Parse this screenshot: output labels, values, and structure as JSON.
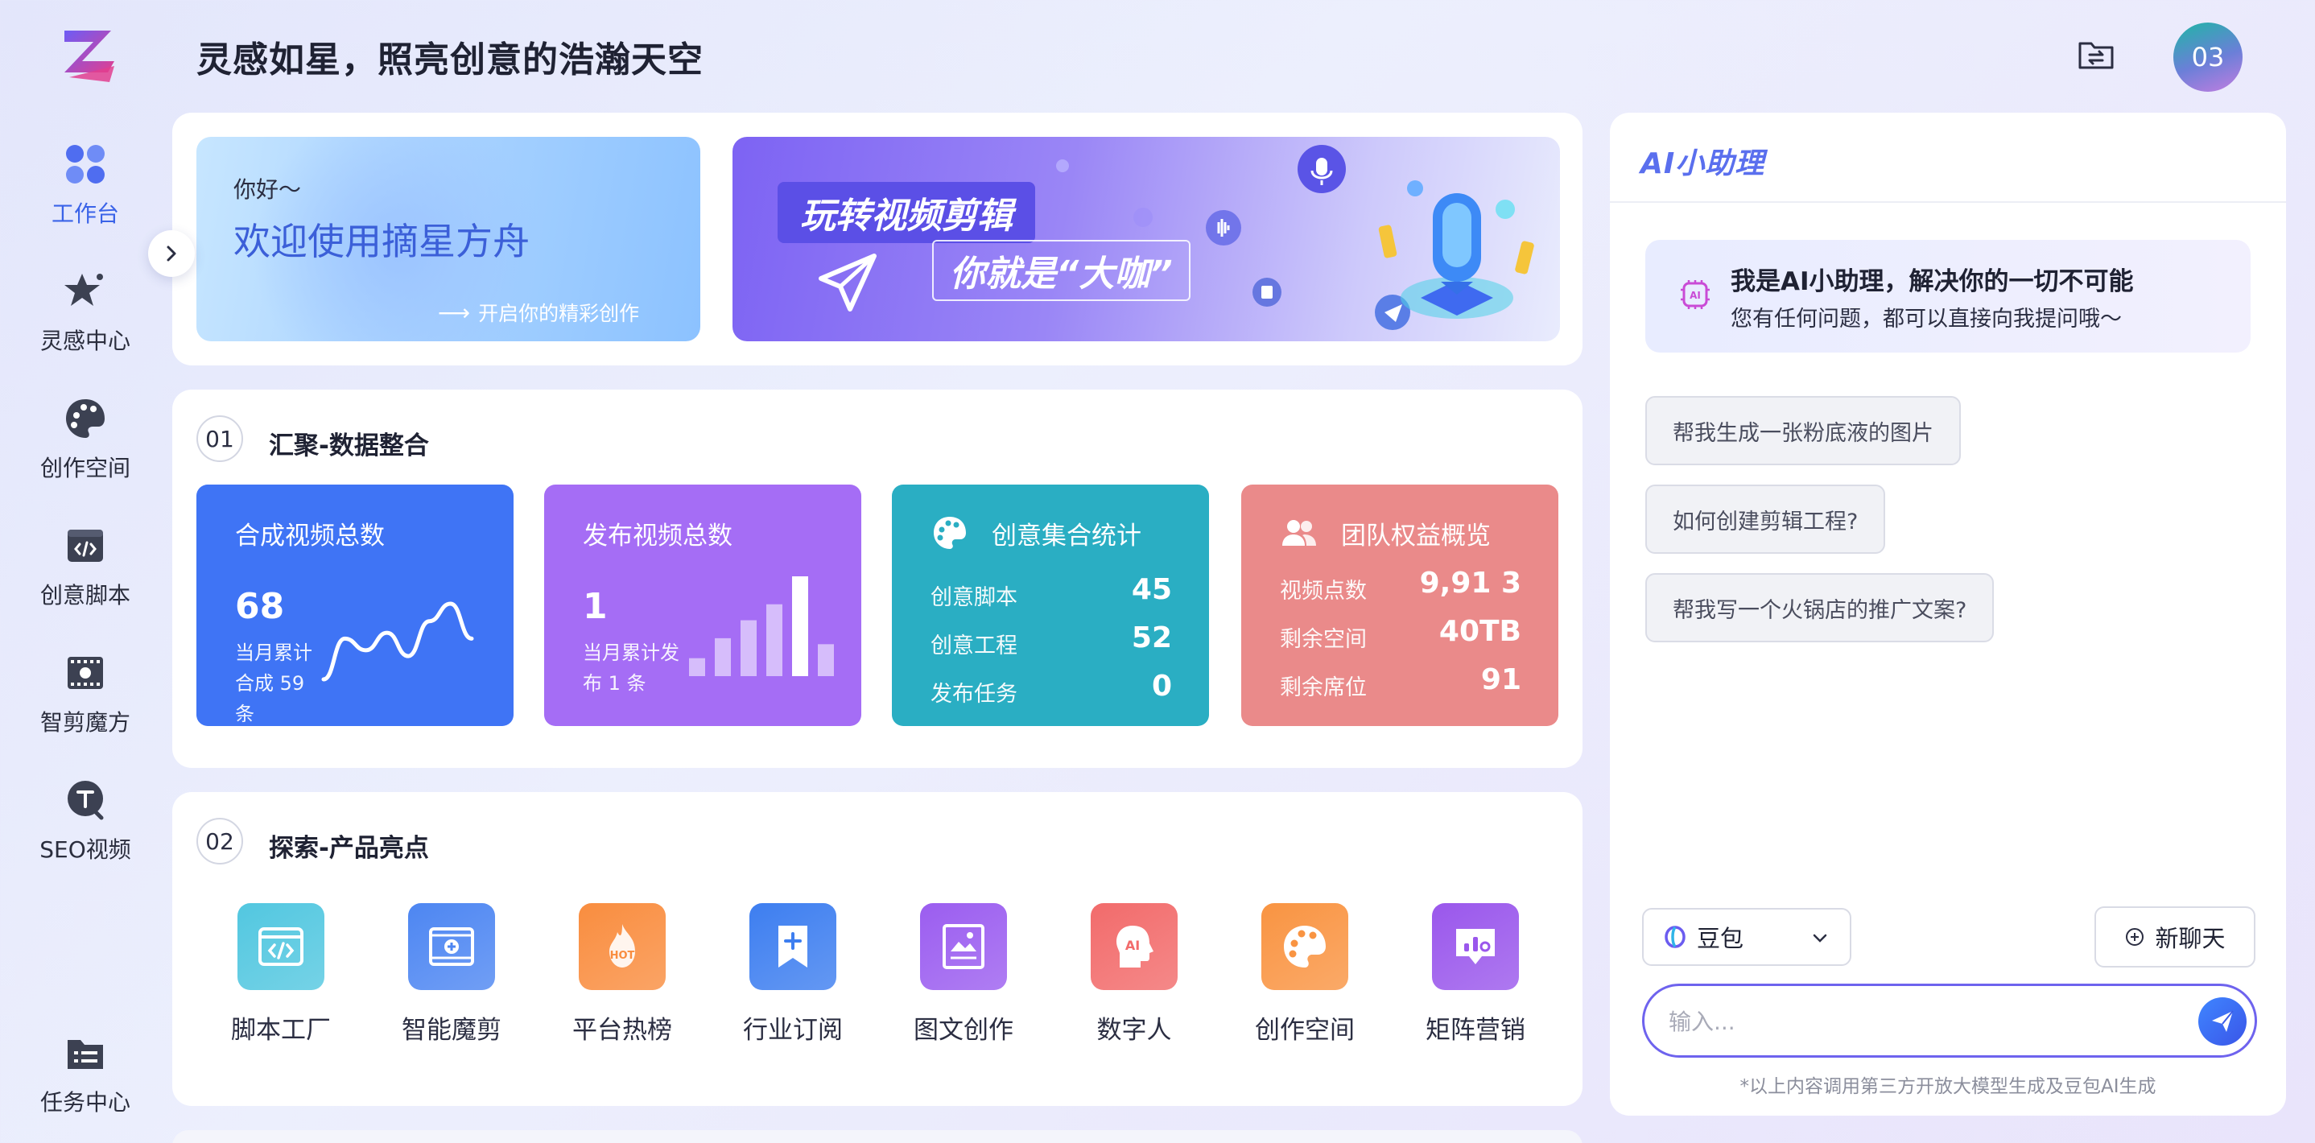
{
  "header": {
    "title": "灵感如星，照亮创意的浩瀚天空",
    "avatar_text": "03"
  },
  "sidebar": {
    "items": [
      {
        "label": "工作台",
        "icon": "grid-icon",
        "active": true
      },
      {
        "label": "灵感中心",
        "icon": "sparkle-star-icon"
      },
      {
        "label": "创作空间",
        "icon": "palette-icon"
      },
      {
        "label": "创意脚本",
        "icon": "code-window-icon"
      },
      {
        "label": "智剪魔方",
        "icon": "film-icon"
      },
      {
        "label": "SEO视频",
        "icon": "text-badge-icon"
      },
      {
        "label": "任务中心",
        "icon": "task-folder-icon"
      }
    ]
  },
  "hero": {
    "greeting": "你好～",
    "welcome": "欢迎使用摘星方舟",
    "cta": "开启你的精彩创作",
    "banner_line1": "玩转视频剪辑",
    "banner_line2": "你就是“大咖”"
  },
  "section1": {
    "num": "01",
    "title": "汇聚-数据整合",
    "cards": {
      "videos": {
        "title": "合成视频总数",
        "value": "68",
        "sub": "当月累计合成 59 条",
        "color": "#3f74f5",
        "trend": [
          20,
          34,
          30,
          36,
          28,
          40,
          46,
          34
        ]
      },
      "published": {
        "title": "发布视频总数",
        "value": "1",
        "sub": "当月累计发布 1 条",
        "color": "#a56df5",
        "bars": [
          0.18,
          0.38,
          0.56,
          0.72,
          1.0,
          0.32
        ]
      },
      "creative": {
        "title": "创意集合统计",
        "color": "#2aaec3",
        "rows": [
          {
            "label": "创意脚本",
            "value": "45"
          },
          {
            "label": "创意工程",
            "value": "52"
          },
          {
            "label": "发布任务",
            "value": "0"
          }
        ]
      },
      "team": {
        "title": "团队权益概览",
        "color": "#ea8a8a",
        "rows": [
          {
            "label": "视频点数",
            "value": "9,91 3"
          },
          {
            "label": "剩余空间",
            "value": "40TB"
          },
          {
            "label": "剩余席位",
            "value": "91"
          }
        ]
      }
    }
  },
  "section2": {
    "num": "02",
    "title": "探索-产品亮点",
    "products": [
      {
        "label": "脚本工厂",
        "icon": "code-window-icon",
        "color": "#52c7e0"
      },
      {
        "label": "智能魔剪",
        "icon": "film-plus-icon",
        "color": "#4d86f2"
      },
      {
        "label": "平台热榜",
        "icon": "hot-flame-icon",
        "color": "#f98d3f"
      },
      {
        "label": "行业订阅",
        "icon": "bookmark-plus-icon",
        "color": "#3d7ef0"
      },
      {
        "label": "图文创作",
        "icon": "image-doc-icon",
        "color": "#9b5df0"
      },
      {
        "label": "数字人",
        "icon": "ai-head-icon",
        "color": "#f26b6b"
      },
      {
        "label": "创作空间",
        "icon": "palette-icon",
        "color": "#f99442"
      },
      {
        "label": "矩阵营销",
        "icon": "chart-bubble-icon",
        "color": "#9a57ec"
      }
    ]
  },
  "assistant": {
    "brand": "AI小助理",
    "intro_title": "我是AI小助理，解决你的一切不可能",
    "intro_sub": "您有任何问题，都可以直接向我提问哦～",
    "suggestions": [
      "帮我生成一张粉底液的图片",
      "如何创建剪辑工程?",
      "帮我写一个火锅店的推广文案?"
    ],
    "model": "豆包",
    "new_chat": "新聊天",
    "input_placeholder": "输入...",
    "disclaimer": "*以上内容调用第三方开放大模型生成及豆包AI生成"
  }
}
